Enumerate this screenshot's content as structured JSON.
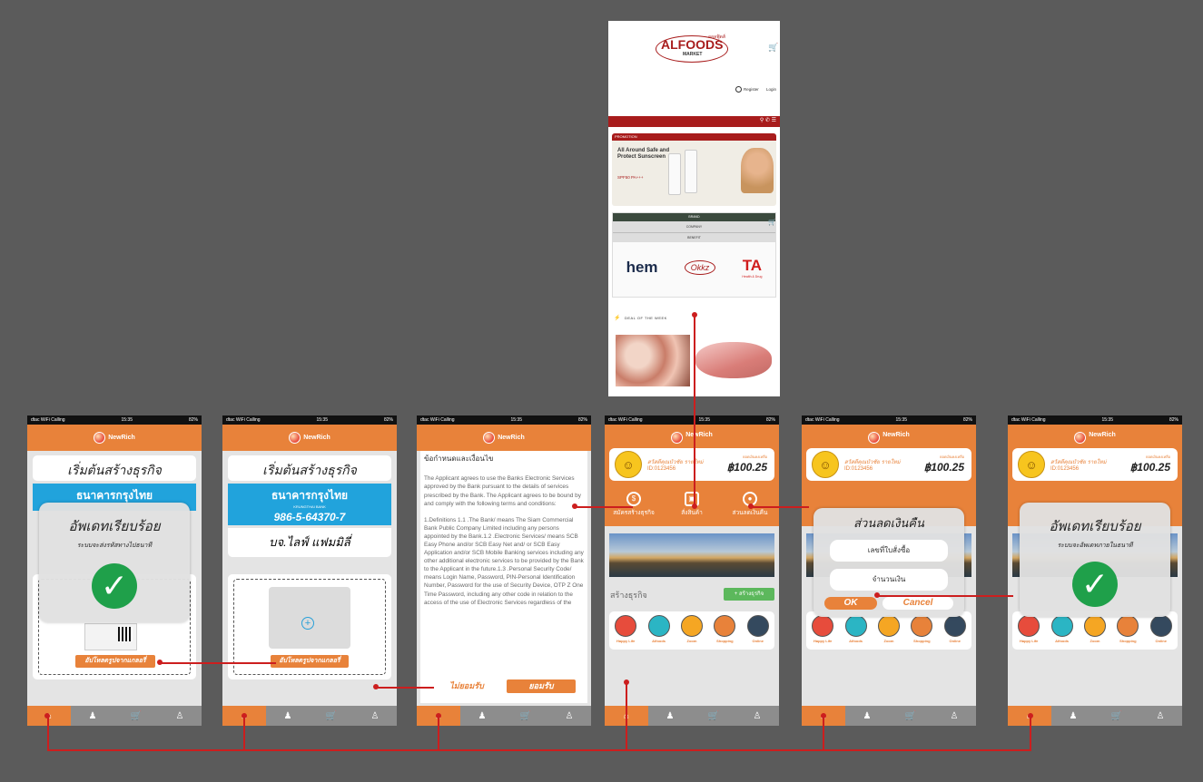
{
  "common": {
    "carrier": "dtac WiFi Calling",
    "time": "15:35",
    "battery": "82%",
    "app_name": "NewRich"
  },
  "nav_icons": [
    "home-icon",
    "group-icon",
    "cart-icon",
    "profile-icon"
  ],
  "screen1": {
    "title": "เริ่มต้นสร้างธุรกิจ",
    "overlay_title": "อัพเดทเรียบร้อย",
    "overlay_sub": "ระบบจะส่งรหัสทางไปธนาที",
    "upload_btn": "อัปโหลดรูปจากแกลอรี่",
    "bank_name": "ธนาคารกรุงไทย"
  },
  "screen2": {
    "title": "เริ่มต้นสร้างธุรกิจ",
    "bank_name": "ธนาคารกรุงไทย",
    "bank_en": "KRUNGTHAI BANK",
    "account": "986-5-64370-7",
    "company": "บจ.ไลฟ์ แฟมมิลี่",
    "upload_btn": "อัปโหลดรูปจากแกลอรี่"
  },
  "screen3": {
    "heading": "ข้อกำหนดและเงื่อนไข",
    "para1": "The Applicant agrees to use the Banks Electronic Services approved by the Bank pursuant to the details of services prescribed by the Bank. The Applicant agrees to be bound by and comply with the following terms and conditions:",
    "para2": "1.Definitions 1.1 .The Bank/ means The Siam Commercial Bank Public Company Limited including any persons appointed by the Bank.1.2 .Electronic Services/ means SCB Easy Phone and/or SCB Easy Net and/ or SCB Easy Application and/or SCB Mobile Banking services including any other additional electronic services to be provided by the Bank to the Applicant in the future.1.3 .Personal Security Code/ means Login Name, Password, PIN-Personal Identification Number, Password for the use of Security Device, OTP Z One Time Password, including any other code in relation to the access of the use of Electronic Services regardless of the",
    "decline": "ไม่ยอมรับ",
    "accept": "ยอมรับ"
  },
  "screen4": {
    "user_name": "สวัสดีคุณบัวชัย",
    "user_tag": "รายใหม่",
    "user_id": "ID:0123456",
    "balance_label": "ยอดเงินคงเหลือ",
    "balance": "฿100.25",
    "menu": [
      "สมัครสร้างธุรกิจ",
      "สั่งสินค้า",
      "ส่วนลดเงินคืน"
    ],
    "biz_label": "สร้างธุรกิจ",
    "biz_btn": "+ สร้างธุรกิจ",
    "icons": [
      "Happy Life",
      "Alfoods",
      "Zoom",
      "Shopping",
      "Online"
    ]
  },
  "screen5": {
    "overlay_title": "ส่วนลดเงินคืน",
    "field1": "เลขที่ใบสั่งซื้อ",
    "field2": "จำนวนเงิน",
    "ok": "OK",
    "cancel": "Cancel"
  },
  "screen6": {
    "overlay_title": "อัพเดทเรียบร้อย",
    "overlay_sub": "ระบบจะอัพเดทภายในธนาที"
  },
  "web": {
    "brand": "ALFOODS",
    "brand_thai": "ออลฟู้ดส์",
    "brand_sub": "MARKET",
    "register": "Register",
    "login": "Login",
    "promo_label": "PROMOTION",
    "promo_text": "All Around Safe and Protect Sunscreen",
    "promo_spf": "SPF50 PA+++",
    "tab1": "BRAND",
    "tab2": "COMPANY",
    "tab3": "BENEFIT",
    "logo1": "hem",
    "logo2": "Okkz",
    "logo3": "TA",
    "logo3_sub": "Health & Drug",
    "deal": "DEAL OF THE WEEK"
  },
  "colors": {
    "orange": "#e8823a",
    "connector": "#cc1e1e",
    "bank_blue": "#21a3dc",
    "check_green": "#1fa04a",
    "web_red": "#a81c1c"
  }
}
